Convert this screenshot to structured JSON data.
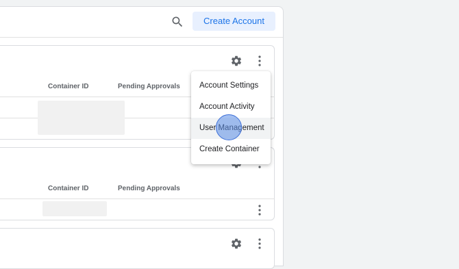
{
  "header": {
    "create_account_label": "Create Account"
  },
  "table": {
    "col_container_id": "Container ID",
    "col_pending": "Pending Approvals"
  },
  "menu": {
    "items": [
      "Account Settings",
      "Account Activity",
      "User Management",
      "Create Container"
    ],
    "highlighted_index": 2
  },
  "icons": {
    "search": "search-icon",
    "gear": "gear-icon",
    "more": "more-vert-icon"
  },
  "colors": {
    "accent": "#1a73e8",
    "accent_bg": "#e8f0fe"
  }
}
